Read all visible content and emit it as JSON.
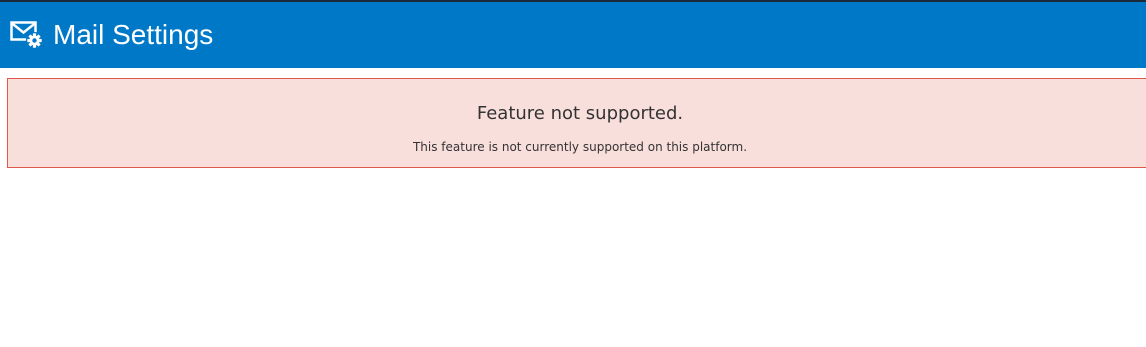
{
  "header": {
    "title": "Mail Settings",
    "icon": "mail-settings-icon",
    "background_color": "#0078c8",
    "text_color": "#ffffff"
  },
  "alert": {
    "title": "Feature not supported.",
    "message": "This feature is not currently supported on this platform.",
    "background_color": "#f9dfdc",
    "border_color": "#e0584a"
  }
}
